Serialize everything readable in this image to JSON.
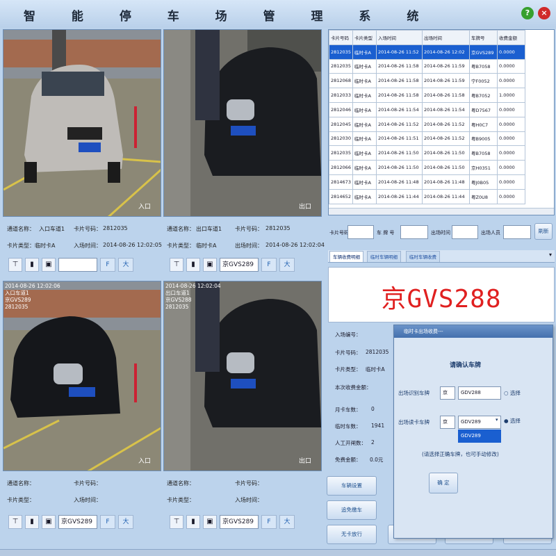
{
  "window": {
    "title": "智 能 停 车 场 管 理 系 统",
    "btn_help": "?",
    "btn_close": "×"
  },
  "cameras": [
    {
      "corner_label": "入口",
      "overlay": []
    },
    {
      "corner_label": "出口",
      "overlay": []
    },
    {
      "corner_label": "入口",
      "overlay": [
        "2014-08-26 12:02:06",
        "入口车道1",
        "京GVS289",
        "2812035"
      ]
    },
    {
      "corner_label": "出口",
      "overlay": [
        "2014-08-26 12:02:04",
        "出口车道1",
        "京GVS288",
        "2812035"
      ]
    }
  ],
  "entry_info": {
    "lane_label": "通道名称：",
    "lane_value": "入口车道1",
    "card_no_label": "卡片号码：",
    "card_no_value": "2812035",
    "card_type_label": "卡片类型：",
    "card_type_value": "临时卡A",
    "time_label": "入场时间：",
    "time_value": "2014-08-26 12:02:05"
  },
  "exit_info": {
    "lane_label": "通道名称：",
    "lane_value": "出口车道1",
    "card_no_label": "卡片号码：",
    "card_no_value": "2812035",
    "card_type_label": "卡片类型：",
    "card_type_value": "临时卡A",
    "time_label": "出场时间：",
    "time_value": "2014-08-26 12:02:04"
  },
  "entry_info2": {
    "lane_label": "通道名称：",
    "card_no_label": "卡片号码：",
    "card_type_label": "卡片类型：",
    "time_label": "入场时间："
  },
  "exit_info2": {
    "lane_label": "通道名称：",
    "card_no_label": "卡片号码：",
    "card_type_label": "卡片类型：",
    "time_label": "入场时间："
  },
  "toolbars": {
    "tl_plate": "",
    "tr_plate": "京GVS289",
    "bl_plate": "京GVS289",
    "br_plate": "京GVS289",
    "prev": "F",
    "next": "大"
  },
  "records": {
    "headers": [
      "卡片号码",
      "卡片类型",
      "入场时间",
      "出场时间",
      "车牌号",
      "收费金额"
    ],
    "rows": [
      [
        "2812035",
        "临时卡A",
        "2014-08-26 11:52",
        "2014-08-26 12:02",
        "京GVS289",
        "0.0000"
      ],
      [
        "2812035",
        "临时卡A",
        "2014-08-26 11:58",
        "2014-08-26 11:59",
        "粤B7058",
        "0.0000"
      ],
      [
        "2812068",
        "临时卡A",
        "2014-08-26 11:58",
        "2014-08-26 11:59",
        "宁F0052",
        "0.0000"
      ],
      [
        "2812033",
        "临时卡A",
        "2014-08-26 11:58",
        "2014-08-26 11:58",
        "粤B7052",
        "1.0000"
      ],
      [
        "2812046",
        "临时卡A",
        "2014-08-26 11:54",
        "2014-08-26 11:54",
        "粤D7567",
        "0.0000"
      ],
      [
        "2812045",
        "临时卡A",
        "2014-08-26 11:52",
        "2014-08-26 11:52",
        "粤H0C7",
        "0.0000"
      ],
      [
        "2812030",
        "临时卡A",
        "2014-08-26 11:51",
        "2014-08-26 11:52",
        "粤B9005",
        "0.0000"
      ],
      [
        "2812035",
        "临时卡A",
        "2014-08-26 11:50",
        "2014-08-26 11:50",
        "粤B7058",
        "0.0000"
      ],
      [
        "2812066",
        "临时卡A",
        "2014-08-26 11:50",
        "2014-08-26 11:50",
        "京H0351",
        "0.0000"
      ],
      [
        "2814673",
        "临时卡A",
        "2014-08-26 11:48",
        "2014-08-26 11:48",
        "粤J0B05",
        "0.0000"
      ],
      [
        "2814652",
        "临时卡A",
        "2014-08-26 11:44",
        "2014-08-26 11:44",
        "粤Z0U8",
        "0.0000"
      ]
    ]
  },
  "search": {
    "card_label": "卡片号码",
    "plate_label": "车 牌 号",
    "exit_label": "出场时间",
    "person_label": "出场人员",
    "button": "刷新"
  },
  "tabs": [
    "车辆收费明细",
    "临时车辆明细",
    "临时车辆收费"
  ],
  "plate_display": "京GVS288",
  "charge_info": {
    "entry_no": "入场编号：",
    "card_no_label": "卡片号码：",
    "card_no_value": "2812035",
    "card_type_label": "卡片类型：",
    "card_type_value": "临时卡A",
    "base_fee": "本次收费金额：",
    "month_label": "月卡车数：",
    "month_value": "0",
    "temp_label": "临时车数：",
    "temp_value": "1941",
    "manual_label": "人工开闸数：",
    "manual_value": "2",
    "free_label": "免费金额：",
    "free_value": "0.0元"
  },
  "side_buttons": [
    "车辆设置",
    "追免缴车",
    "无卡放行"
  ],
  "dialog": {
    "title": "临时卡出场收费---",
    "heading": "请确认车牌",
    "recog_label": "出场识别车牌",
    "recog_prefix": "京",
    "recog_value": "GDV288",
    "recog_check": "选择",
    "entry_label": "出场读卡车牌",
    "entry_prefix": "京",
    "entry_value": "GDV289",
    "entry_check": "选择",
    "dropdown_option": "GDV289",
    "hint": "(请选择正确车牌，也可手动修改)",
    "confirm": "确 定"
  },
  "colors": {
    "plate_red": "#e02020",
    "selection_blue": "#1a5fd0",
    "plate_blue": "#1e4fbf"
  }
}
